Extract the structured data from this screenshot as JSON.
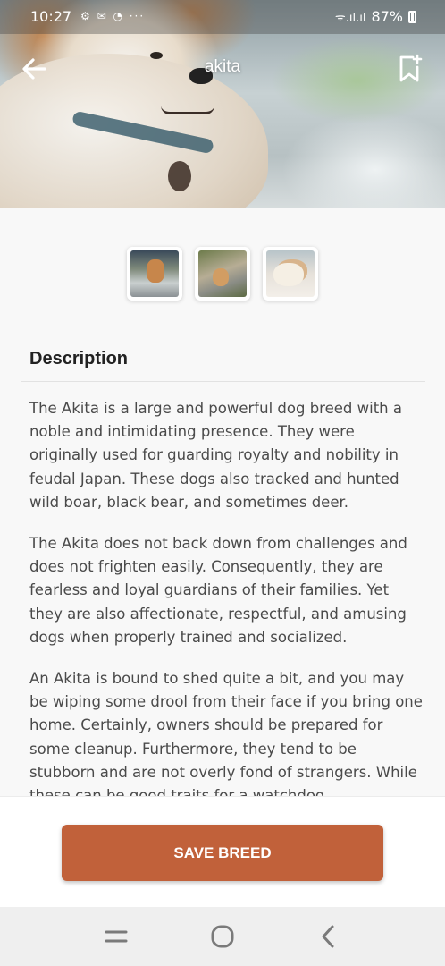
{
  "status_bar": {
    "time": "10:27",
    "left_icons": "⚙ ✉ ◔  ···",
    "signal": "ᯤ.ıl.ıl",
    "battery_percent": "87%"
  },
  "header": {
    "title": "akita",
    "back_icon": "arrow-left-icon",
    "bookmark_icon": "bookmark-add-icon"
  },
  "gallery": {
    "thumbnails": [
      {
        "name": "akita-photo-1"
      },
      {
        "name": "akita-photo-2"
      },
      {
        "name": "akita-photo-3"
      }
    ]
  },
  "description": {
    "heading": "Description",
    "paragraphs": [
      "The Akita is a large and powerful dog breed with a noble and intimidating presence. They were originally used for guarding royalty and nobility in feudal Japan. These dogs also tracked and hunted wild boar, black bear, and sometimes deer.",
      "The Akita does not back down from challenges and does not frighten easily. Consequently, they are fearless and loyal guardians of their families. Yet they are also affectionate, respectful, and amusing dogs when properly trained and socialized.",
      "An Akita is bound to shed quite a bit, and you may be wiping some drool from their face if you bring one home. Certainly, owners should be prepared for some cleanup. Furthermore, they tend to be stubborn and are not overly fond of strangers. While these can be good traits for a watchdog"
    ]
  },
  "actions": {
    "save_label": "SAVE BREED"
  },
  "colors": {
    "accent": "#c1613a",
    "background": "#f8f8f8"
  }
}
